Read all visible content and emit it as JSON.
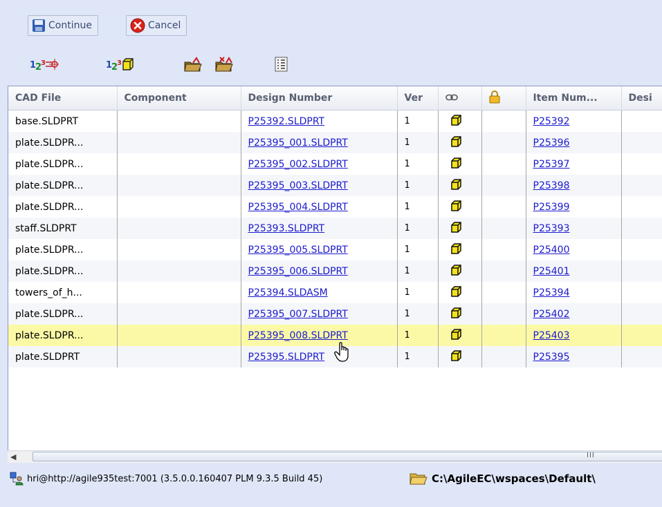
{
  "toolbar": {
    "continue_label": "Continue",
    "cancel_label": "Cancel"
  },
  "icons": {
    "continue": "save-disk-icon",
    "cancel": "cancel-x-icon",
    "tool1": "renumber-component-icon",
    "tool2": "renumber-part-icon",
    "tool3": "folder-up-icon",
    "tool4": "folder-cancel-icon",
    "tool5": "checklist-icon",
    "link_header": "link-icon",
    "lock_header": "lock-icon",
    "part_cell": "yellow-cube-icon",
    "status_user": "network-user-icon",
    "status_folder": "folder-icon"
  },
  "grid": {
    "columns": [
      "CAD File",
      "Component",
      "Design Number",
      "Ver",
      "",
      "",
      "Item Num...",
      "Desi"
    ],
    "rows": [
      {
        "cad_file": "base.SLDPRT",
        "component": "",
        "design_number": "P25392.SLDPRT",
        "ver": "1",
        "item_number": "P25392"
      },
      {
        "cad_file": "plate.SLDPR...",
        "component": "",
        "design_number": "P25395_001.SLDPRT",
        "ver": "1",
        "item_number": "P25396"
      },
      {
        "cad_file": "plate.SLDPR...",
        "component": "",
        "design_number": "P25395_002.SLDPRT",
        "ver": "1",
        "item_number": "P25397"
      },
      {
        "cad_file": "plate.SLDPR...",
        "component": "",
        "design_number": "P25395_003.SLDPRT",
        "ver": "1",
        "item_number": "P25398"
      },
      {
        "cad_file": "plate.SLDPR...",
        "component": "",
        "design_number": "P25395_004.SLDPRT",
        "ver": "1",
        "item_number": "P25399"
      },
      {
        "cad_file": "staff.SLDPRT",
        "component": "",
        "design_number": "P25393.SLDPRT",
        "ver": "1",
        "item_number": "P25393"
      },
      {
        "cad_file": "plate.SLDPR...",
        "component": "",
        "design_number": "P25395_005.SLDPRT",
        "ver": "1",
        "item_number": "P25400"
      },
      {
        "cad_file": "plate.SLDPR...",
        "component": "",
        "design_number": "P25395_006.SLDPRT",
        "ver": "1",
        "item_number": "P25401"
      },
      {
        "cad_file": "towers_of_h...",
        "component": "",
        "design_number": "P25394.SLDASM",
        "ver": "1",
        "item_number": "P25394"
      },
      {
        "cad_file": "plate.SLDPR...",
        "component": "",
        "design_number": "P25395_007.SLDPRT",
        "ver": "1",
        "item_number": "P25402"
      },
      {
        "cad_file": "plate.SLDPR...",
        "component": "",
        "design_number": "P25395_008.SLDPRT",
        "ver": "1",
        "item_number": "P25403"
      },
      {
        "cad_file": "plate.SLDPRT",
        "component": "",
        "design_number": "P25395.SLDPRT",
        "ver": "1",
        "item_number": "P25395"
      }
    ],
    "selected_row": 10
  },
  "scrollbar": {
    "grip": "III"
  },
  "status": {
    "connection": "hri@http://agile935test:7001 (3.5.0.0.160407 PLM 9.3.5 Build 45)",
    "workspace_path": "C:\\AgileEC\\wspaces\\Default\\"
  },
  "colors": {
    "background": "#dfe6f7",
    "selected_row": "#fbf9a6",
    "link": "#1a1acc"
  }
}
